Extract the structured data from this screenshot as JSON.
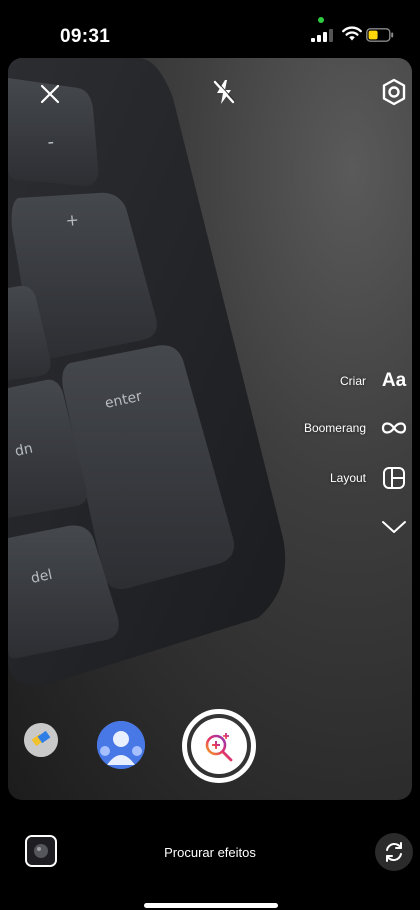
{
  "status": {
    "time": "09:31"
  },
  "camera": {
    "photo_keys": [
      "+",
      "enter",
      "dn",
      "del",
      "-"
    ]
  },
  "top_controls": {
    "close_icon": "close-icon",
    "flash_icon": "flash-off-icon",
    "settings_icon": "settings-icon"
  },
  "side_menu": {
    "items": [
      {
        "label": "Criar",
        "icon": "text-create-icon",
        "glyph": "Aa"
      },
      {
        "label": "Boomerang",
        "icon": "boomerang-icon"
      },
      {
        "label": "Layout",
        "icon": "layout-icon"
      }
    ],
    "more_icon": "chevron-down-icon"
  },
  "bottom": {
    "effects_label": "Procurar efeitos",
    "flip_icon": "flip-camera-icon",
    "gallery_icon": "gallery-thumbnail"
  }
}
